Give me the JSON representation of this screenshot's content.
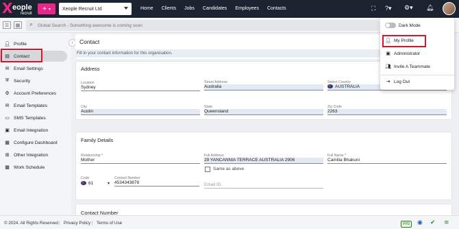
{
  "app": {
    "logo_name": "eople",
    "logo_sub": "recruit",
    "company": "Xeople Recruit Ltd"
  },
  "nav": [
    "Home",
    "Clients",
    "Jobs",
    "Candidates",
    "Employees",
    "Contacts"
  ],
  "search": {
    "placeholder": "Global Search - Something awesome is coming soon"
  },
  "sidebar": {
    "items": [
      {
        "label": "Profile",
        "icon": "person-icon"
      },
      {
        "label": "Contact",
        "icon": "contact-card-icon"
      },
      {
        "label": "Email Settings",
        "icon": "envelope-icon"
      },
      {
        "label": "Security",
        "icon": "shield-icon"
      },
      {
        "label": "Account Preferences",
        "icon": "preferences-icon"
      },
      {
        "label": "Email Templates",
        "icon": "envelope-template-icon"
      },
      {
        "label": "SMS Templates",
        "icon": "chat-icon"
      },
      {
        "label": "Email Integration",
        "icon": "email-integration-icon"
      },
      {
        "label": "Configure Dashboard",
        "icon": "dashboard-grid-icon"
      },
      {
        "label": "Other Integration",
        "icon": "integration-icon"
      },
      {
        "label": "Work Schedule",
        "icon": "calendar-icon"
      }
    ]
  },
  "page": {
    "title": "Contact",
    "notice": "Fill in your contact information for this organisation."
  },
  "address": {
    "title": "Address",
    "location_label": "Location",
    "location": "Sydney",
    "street_label": "Street Address",
    "street": "Australia",
    "country_label": "Select Country",
    "country": "AUSTRALIA",
    "city_label": "City",
    "city": "Austin",
    "state_label": "State",
    "state": "Queensland",
    "zip_label": "Zip Code",
    "zip": "2263"
  },
  "family": {
    "title": "Family Details",
    "relationship_label": "Relationship *",
    "relationship": "Mother",
    "full_address_label": "Full Address",
    "full_address": "29 YANCANNIA TERRACE  AUSTRALIA 2906",
    "full_name_label": "Full Name *",
    "full_name": "Camilia Bhakuni",
    "same_as_above": "Same as above",
    "code_label": "Code",
    "code": "61",
    "contact_number_label": "Contact Number",
    "contact_number": "4534343878",
    "email_placeholder": "Email ID"
  },
  "contact_number_section": {
    "title": "Contact Number"
  },
  "footer": {
    "copyright": "© 2024. All Rights Reserved",
    "privacy": "Privacy Policy",
    "terms": "Terms of Use",
    "sep": "|",
    "badge": "PPD"
  },
  "user_menu": {
    "dark_mode": "Dark Mode",
    "my_profile": "My Profile",
    "administrator": "Administrator",
    "invite": "Invite A Teammate",
    "logout": "Log Out"
  },
  "colors": {
    "topbar": "#1b2330",
    "accent": "#e8278a",
    "highlight": "#e0102a"
  }
}
